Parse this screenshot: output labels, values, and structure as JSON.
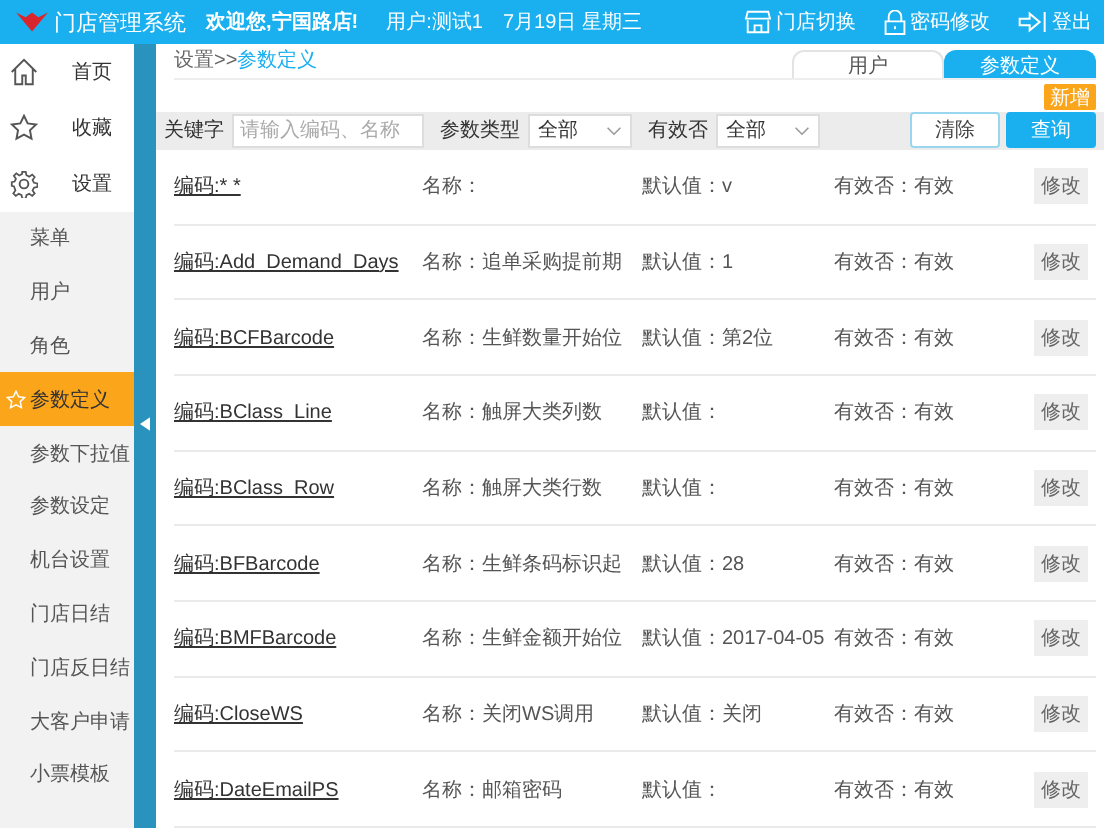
{
  "header": {
    "title": "门店管理系统",
    "welcome": "欢迎您,宁国路店!",
    "user": "用户:测试1",
    "date": "7月19日 星期三",
    "actions": [
      {
        "kind": "store",
        "label": "门店切换"
      },
      {
        "kind": "lock",
        "label": "密码修改"
      },
      {
        "kind": "logout",
        "label": "登出"
      }
    ]
  },
  "sidebar": {
    "main_items": [
      {
        "kind": "home",
        "label": "首页"
      },
      {
        "kind": "star",
        "label": "收藏"
      },
      {
        "kind": "gear",
        "label": "设置"
      }
    ],
    "sub_items": [
      {
        "label": "菜单",
        "selected": false
      },
      {
        "label": "用户",
        "selected": false
      },
      {
        "label": "角色",
        "selected": false
      },
      {
        "label": "参数定义",
        "selected": true
      },
      {
        "label": "参数下拉值",
        "selected": false
      },
      {
        "label": "参数设定",
        "selected": false
      },
      {
        "label": "机台设置",
        "selected": false
      },
      {
        "label": "门店日结",
        "selected": false
      },
      {
        "label": "门店反日结",
        "selected": false
      },
      {
        "label": "大客户申请",
        "selected": false
      },
      {
        "label": "小票模板",
        "selected": false
      }
    ]
  },
  "breadcrumb": {
    "parent": "设置>>",
    "current": "参数定义"
  },
  "tabs": [
    {
      "label": "用户",
      "selected": false
    },
    {
      "label": "参数定义",
      "selected": true
    }
  ],
  "add_button": "新增",
  "filters": {
    "keyword_label": "关键字",
    "keyword_placeholder": "请输入编码、名称",
    "type_label": "参数类型",
    "type_value": "全部",
    "valid_label": "有效否",
    "valid_value": "全部",
    "clear_button": "清除",
    "search_button": "查询"
  },
  "rows": [
    {
      "code": "编码:* *",
      "name": "名称：",
      "default": "默认值：v",
      "valid": "有效否：有效",
      "action": "修改"
    },
    {
      "code": "编码:Add_Demand_Days",
      "name": "名称：追单采购提前期",
      "default": "默认值：1",
      "valid": "有效否：有效",
      "action": "修改"
    },
    {
      "code": "编码:BCFBarcode",
      "name": "名称：生鲜数量开始位",
      "default": "默认值：第2位",
      "valid": "有效否：有效",
      "action": "修改"
    },
    {
      "code": "编码:BClass_Line",
      "name": "名称：触屏大类列数",
      "default": "默认值：",
      "valid": "有效否：有效",
      "action": "修改"
    },
    {
      "code": "编码:BClass_Row",
      "name": "名称：触屏大类行数",
      "default": "默认值：",
      "valid": "有效否：有效",
      "action": "修改"
    },
    {
      "code": "编码:BFBarcode",
      "name": "名称：生鲜条码标识起",
      "default": "默认值：28",
      "valid": "有效否：有效",
      "action": "修改"
    },
    {
      "code": "编码:BMFBarcode",
      "name": "名称：生鲜金额开始位",
      "default": "默认值：2017-04-05",
      "valid": "有效否：有效",
      "action": "修改"
    },
    {
      "code": "编码:CloseWS",
      "name": "名称：关闭WS调用",
      "default": "默认值：关闭",
      "valid": "有效否：有效",
      "action": "修改"
    },
    {
      "code": "编码:DateEmailPS",
      "name": "名称：邮箱密码",
      "default": "默认值：",
      "valid": "有效否：有效",
      "action": "修改"
    }
  ]
}
